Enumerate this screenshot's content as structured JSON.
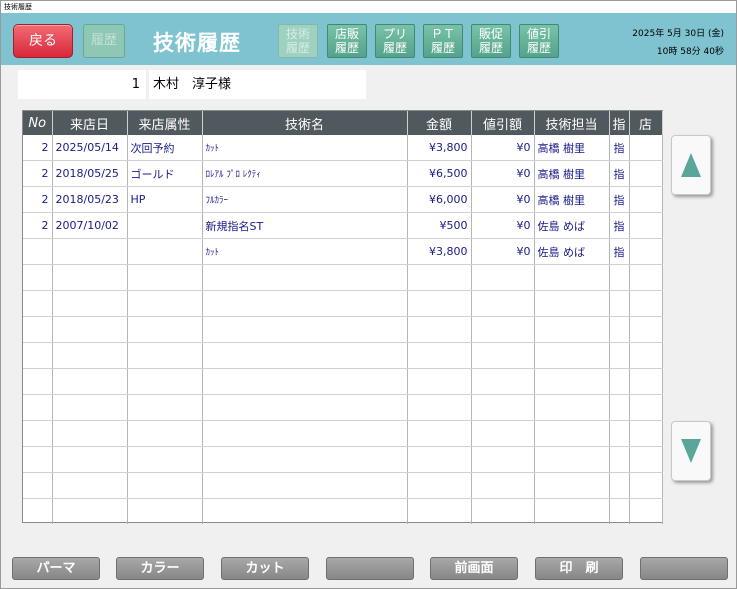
{
  "window": {
    "title": "技術履歴"
  },
  "header": {
    "back_label": "戻る",
    "rireki_label": "履歴",
    "title": "技術履歴",
    "nav_buttons": [
      {
        "line1": "技術",
        "line2": "履歴"
      },
      {
        "line1": "店販",
        "line2": "履歴"
      },
      {
        "line1": "プリ",
        "line2": "履歴"
      },
      {
        "line1": "ＰＴ",
        "line2": "履歴"
      },
      {
        "line1": "販促",
        "line2": "履歴"
      },
      {
        "line1": "値引",
        "line2": "履歴"
      }
    ],
    "date": "2025年 5月 30日 (金)",
    "time": "10時 58分 40秒"
  },
  "customer": {
    "number": "1",
    "name": "木村　淳子様"
  },
  "table": {
    "columns": [
      "No",
      "来店日",
      "来店属性",
      "技術名",
      "金額",
      "値引額",
      "技術担当",
      "指",
      "店"
    ],
    "rows": [
      [
        "2",
        "2025/05/14",
        "次回予約",
        "ｶｯﾄ",
        "¥3,800",
        "¥0",
        "高橋 樹里",
        "指",
        ""
      ],
      [
        "2",
        "2018/05/25",
        "ゴールド",
        "ﾛﾚｱﾙ ﾌﾟﾛ ﾚｸﾃｨ",
        "¥6,500",
        "¥0",
        "高橋 樹里",
        "指",
        ""
      ],
      [
        "2",
        "2018/05/23",
        "HP",
        "ﾌﾙｶﾗｰ",
        "¥6,000",
        "¥0",
        "高橋 樹里",
        "指",
        ""
      ],
      [
        "2",
        "2007/10/02",
        "",
        "新規指名ST",
        "¥500",
        "¥0",
        "佐島 めば",
        "指",
        ""
      ],
      [
        "",
        "",
        "",
        "ｶｯﾄ",
        "¥3,800",
        "¥0",
        "佐島 めば",
        "指",
        ""
      ]
    ]
  },
  "footer": {
    "buttons": [
      "パーマ",
      "カラー",
      "カット",
      "",
      "前画面",
      "印　刷",
      ""
    ]
  },
  "colors": {
    "header_bg": "#7ec3cf",
    "back_button": "#e0394a",
    "table_header": "#505a5e",
    "arrow": "#5aa79a"
  }
}
